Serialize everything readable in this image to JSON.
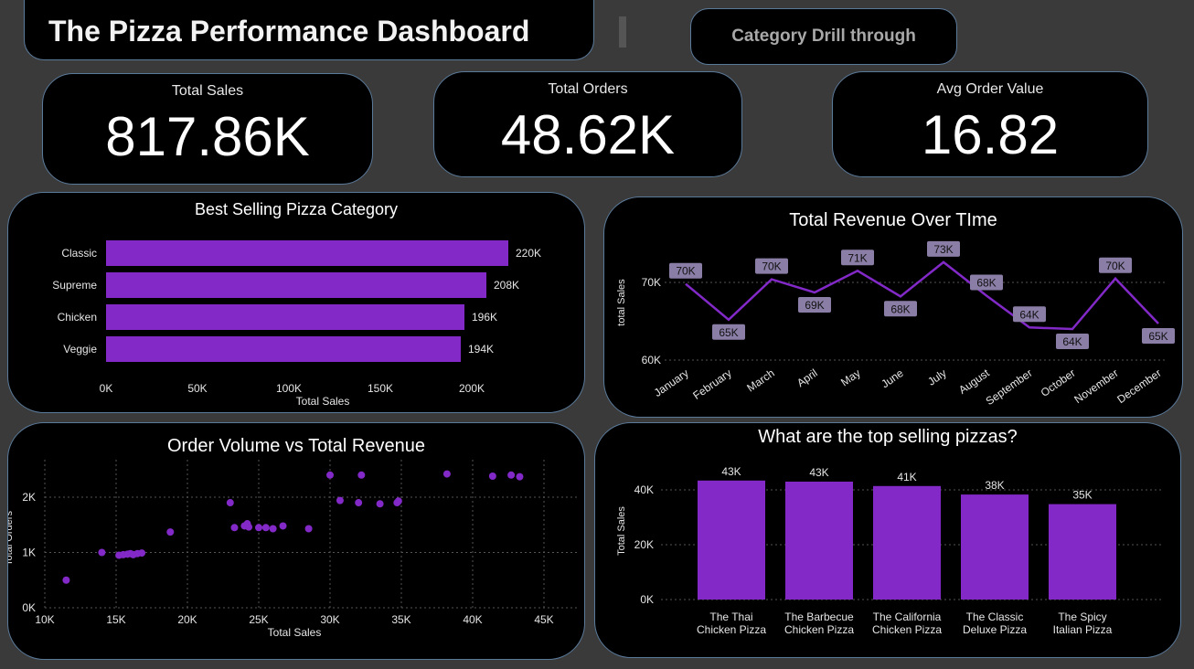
{
  "header": {
    "title": "The Pizza Performance Dashboard",
    "drill_button": "Category Drill through"
  },
  "kpis": [
    {
      "label": "Total Sales",
      "value": "817.86K"
    },
    {
      "label": "Total Orders",
      "value": "48.62K"
    },
    {
      "label": "Avg Order Value",
      "value": "16.82"
    }
  ],
  "colors": {
    "accent": "#8229c8",
    "label_bg": "#8a7ea6",
    "grid": "#555555",
    "panel_border": "#5b7a9a"
  },
  "chart_data": [
    {
      "type": "bar",
      "orientation": "horizontal",
      "title": "Best Selling Pizza Category",
      "categories": [
        "Classic",
        "Supreme",
        "Chicken",
        "Veggie"
      ],
      "values": [
        220,
        208,
        196,
        194
      ],
      "value_labels": [
        "220K",
        "208K",
        "196K",
        "194K"
      ],
      "xlabel": "Total Sales",
      "ylabel": "",
      "xticks": [
        "0K",
        "50K",
        "100K",
        "150K",
        "200K"
      ],
      "xlim": [
        0,
        225
      ]
    },
    {
      "type": "line",
      "title": "Total Revenue Over TIme",
      "categories": [
        "January",
        "February",
        "March",
        "April",
        "May",
        "June",
        "July",
        "August",
        "September",
        "October",
        "November",
        "December"
      ],
      "values": [
        69.8,
        65.2,
        70.4,
        68.7,
        71.5,
        68.2,
        72.6,
        68.3,
        64.2,
        64.0,
        70.5,
        64.7
      ],
      "value_labels": [
        "70K",
        "65K",
        "70K",
        "69K",
        "71K",
        "68K",
        "73K",
        "68K",
        "64K",
        "64K",
        "70K",
        "65K"
      ],
      "xlabel": "",
      "ylabel": "total Sales",
      "yticks": [
        "60K",
        "70K"
      ],
      "ylim": [
        60,
        75
      ],
      "grid": true
    },
    {
      "type": "scatter",
      "title": "Order Volume vs Total Revenue",
      "xlabel": "Total Sales",
      "ylabel": "Total Orders",
      "xticks": [
        "10K",
        "15K",
        "20K",
        "25K",
        "30K",
        "35K",
        "40K",
        "45K"
      ],
      "yticks": [
        "0K",
        "1K",
        "2K"
      ],
      "xlim": [
        10,
        45
      ],
      "ylim": [
        0,
        2.6
      ],
      "grid": true,
      "points": [
        [
          11.5,
          0.5
        ],
        [
          14.0,
          1.0
        ],
        [
          15.2,
          0.95
        ],
        [
          15.5,
          0.96
        ],
        [
          15.8,
          0.97
        ],
        [
          16.0,
          0.98
        ],
        [
          16.2,
          0.96
        ],
        [
          16.5,
          0.98
        ],
        [
          16.8,
          0.99
        ],
        [
          18.8,
          1.37
        ],
        [
          23.0,
          1.9
        ],
        [
          23.3,
          1.45
        ],
        [
          24.0,
          1.48
        ],
        [
          24.2,
          1.52
        ],
        [
          24.3,
          1.46
        ],
        [
          25.0,
          1.45
        ],
        [
          25.5,
          1.45
        ],
        [
          26.0,
          1.43
        ],
        [
          26.7,
          1.48
        ],
        [
          28.5,
          1.43
        ],
        [
          30.0,
          2.4
        ],
        [
          30.7,
          1.94
        ],
        [
          32.0,
          1.9
        ],
        [
          32.2,
          2.4
        ],
        [
          33.5,
          1.88
        ],
        [
          34.7,
          1.9
        ],
        [
          34.8,
          1.93
        ],
        [
          38.2,
          2.42
        ],
        [
          41.4,
          2.38
        ],
        [
          42.7,
          2.4
        ],
        [
          43.3,
          2.37
        ]
      ]
    },
    {
      "type": "bar",
      "title": "What are the top selling pizzas?",
      "categories": [
        "The Thai Chicken Pizza",
        "The Barbecue Chicken Pizza",
        "The California Chicken Pizza",
        "The Classic Deluxe Pizza",
        "The Spicy Italian Pizza"
      ],
      "category_lines": [
        [
          "The Thai",
          "Chicken Pizza"
        ],
        [
          "The Barbecue",
          "Chicken Pizza"
        ],
        [
          "The California",
          "Chicken Pizza"
        ],
        [
          "The Classic",
          "Deluxe Pizza"
        ],
        [
          "The Spicy",
          "Italian Pizza"
        ]
      ],
      "values": [
        43.4,
        43.0,
        41.4,
        38.3,
        34.8
      ],
      "value_labels": [
        "43K",
        "43K",
        "41K",
        "38K",
        "35K"
      ],
      "xlabel": "",
      "ylabel": "Total Sales",
      "yticks": [
        "0K",
        "20K",
        "40K"
      ],
      "ylim": [
        0,
        47
      ]
    }
  ]
}
